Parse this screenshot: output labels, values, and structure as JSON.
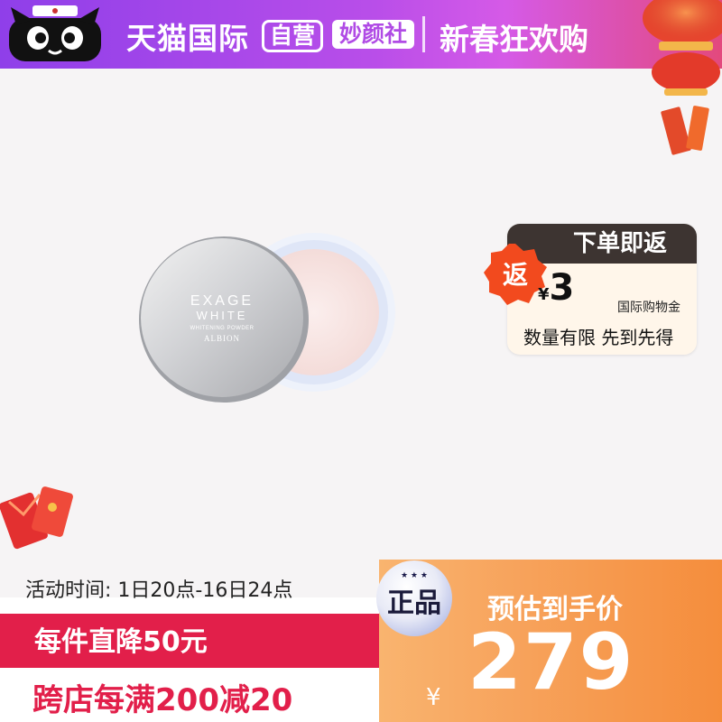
{
  "header": {
    "brand": "天猫国际",
    "self_operated": "自营",
    "shop": "妙颜社",
    "festival": "新春狂欢购"
  },
  "product": {
    "lid_brand": "EXAGE",
    "lid_line": "WHITE",
    "lid_desc": "WHITENING POWDER",
    "lid_maker": "ALBION"
  },
  "promo": {
    "title": "下单即返",
    "badge": "返",
    "currency": "¥",
    "amount": "3",
    "subtitle": "国际购物金",
    "limit": "数量有限  先到先得"
  },
  "campaign": {
    "time": "活动时间: 1日20点-16日24点",
    "deal": "每件直降50元",
    "cross_store": "跨店每满200减20"
  },
  "price": {
    "label": "预估到手价",
    "currency": "¥",
    "value": "279",
    "authentic_badge": "正品"
  },
  "colors": {
    "header_start": "#8f3fe9",
    "header_end": "#e3497d",
    "deal_red": "#e21f4a",
    "price_orange": "#f7a35c"
  }
}
